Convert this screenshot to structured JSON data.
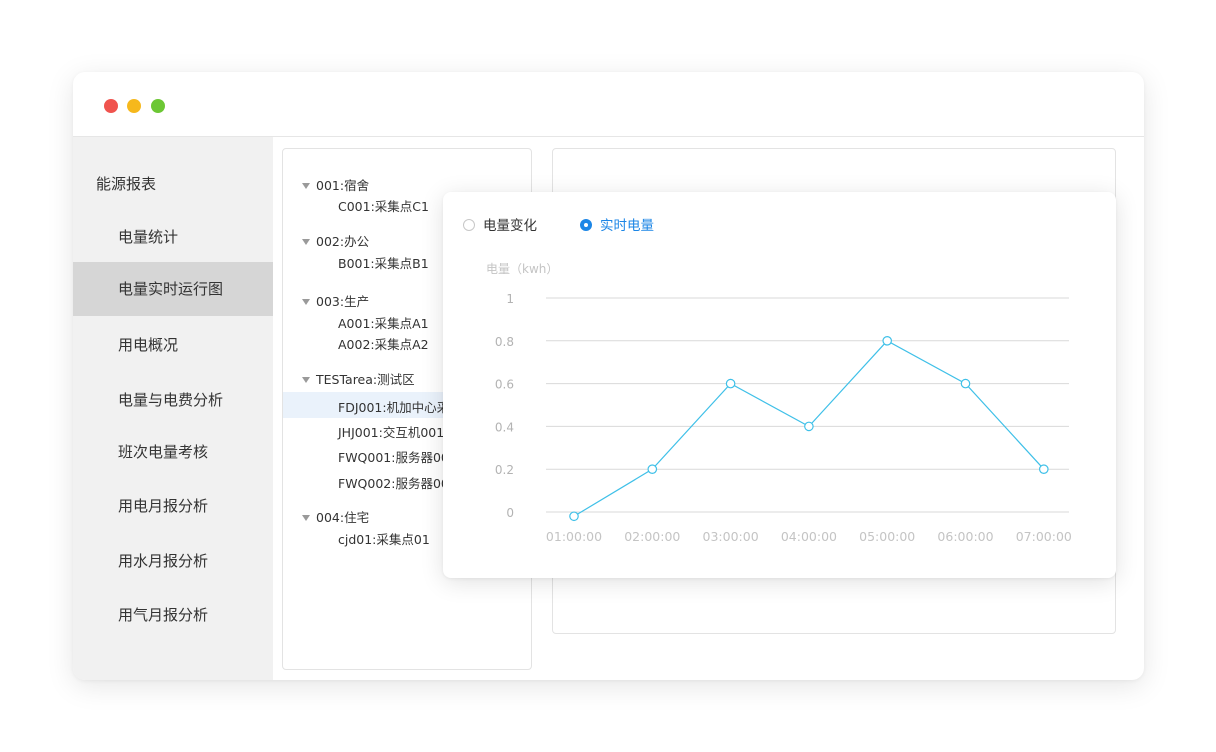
{
  "window": {
    "dots": [
      "#f0534e",
      "#f6b81c",
      "#6cc734"
    ]
  },
  "sidebar": {
    "title": "能源报表",
    "items": [
      {
        "label": "电量统计"
      },
      {
        "label": "电量实时运行图",
        "active": true
      },
      {
        "label": "用电概况"
      },
      {
        "label": "电量与电费分析"
      },
      {
        "label": "班次电量考核"
      },
      {
        "label": "用电月报分析"
      },
      {
        "label": "用水月报分析"
      },
      {
        "label": "用气月报分析"
      }
    ]
  },
  "tree": [
    {
      "label": "001:宿舍",
      "children": [
        "C001:采集点C1"
      ]
    },
    {
      "label": "002:办公",
      "children": [
        "B001:采集点B1"
      ]
    },
    {
      "label": "003:生产",
      "children": [
        "A001:采集点A1",
        "A002:采集点A2"
      ]
    },
    {
      "label": "TESTarea:测试区",
      "children": [
        "FDJ001:机加中心采",
        "JHJ001:交互机001",
        "FWQ001:服务器00",
        "FWQ002:服务器00"
      ]
    },
    {
      "label": "004:住宅",
      "children": [
        "cjd01:采集点01"
      ]
    }
  ],
  "tree_selected": "FDJ001:机加中心采",
  "card": {
    "radios": [
      {
        "label": "电量变化",
        "checked": false
      },
      {
        "label": "实时电量",
        "checked": true
      }
    ]
  },
  "chart_data": {
    "type": "line",
    "ylabel": "电量（kwh）",
    "categories": [
      "01:00:00",
      "02:00:00",
      "03:00:00",
      "04:00:00",
      "05:00:00",
      "06:00:00",
      "07:00:00"
    ],
    "series": [
      {
        "values": [
          -0.02,
          0.2,
          0.6,
          0.4,
          0.8,
          0.6,
          0.2
        ]
      }
    ],
    "yticks": [
      "1",
      "0.8",
      "0.6",
      "0.4",
      "0.2",
      "0"
    ],
    "ylim": [
      0,
      1
    ],
    "grid": true,
    "line_color": "#3fc0e8"
  }
}
